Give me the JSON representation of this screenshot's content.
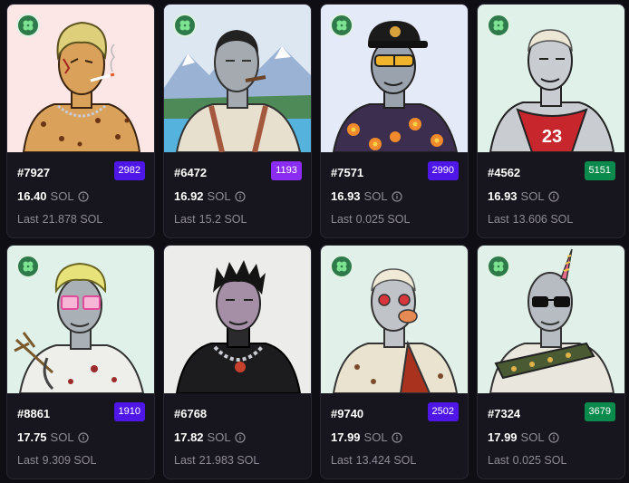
{
  "colors": {
    "rank_purple": "#4f16e8",
    "rank_violet": "#8b2df0",
    "rank_green": "#0a8a4c"
  },
  "badge_icon": "clover-icon",
  "cards": [
    {
      "id": "#7927",
      "rank": "2982",
      "rank_color": "#4f16e8",
      "price": "16.40",
      "currency": "SOL",
      "last_label": "Last",
      "last_price": "21.878 SOL",
      "has_badge": true
    },
    {
      "id": "#6472",
      "rank": "1193",
      "rank_color": "#8b2df0",
      "price": "16.92",
      "currency": "SOL",
      "last_label": "Last",
      "last_price": "15.2 SOL",
      "has_badge": true
    },
    {
      "id": "#7571",
      "rank": "2990",
      "rank_color": "#4f16e8",
      "price": "16.93",
      "currency": "SOL",
      "last_label": "Last",
      "last_price": "0.025 SOL",
      "has_badge": true
    },
    {
      "id": "#4562",
      "rank": "5151",
      "rank_color": "#0a8a4c",
      "price": "16.93",
      "currency": "SOL",
      "last_label": "Last",
      "last_price": "13.606 SOL",
      "has_badge": true
    },
    {
      "id": "#8861",
      "rank": "1910",
      "rank_color": "#4f16e8",
      "price": "17.75",
      "currency": "SOL",
      "last_label": "Last",
      "last_price": "9.309 SOL",
      "has_badge": true
    },
    {
      "id": "#6768",
      "rank": "",
      "rank_color": "",
      "price": "17.82",
      "currency": "SOL",
      "last_label": "Last",
      "last_price": "21.983 SOL",
      "has_badge": false
    },
    {
      "id": "#9740",
      "rank": "2502",
      "rank_color": "#4f16e8",
      "price": "17.99",
      "currency": "SOL",
      "last_label": "Last",
      "last_price": "13.424 SOL",
      "has_badge": true
    },
    {
      "id": "#7324",
      "rank": "3679",
      "rank_color": "#0a8a4c",
      "price": "17.99",
      "currency": "SOL",
      "last_label": "Last",
      "last_price": "0.025 SOL",
      "has_badge": true
    }
  ]
}
